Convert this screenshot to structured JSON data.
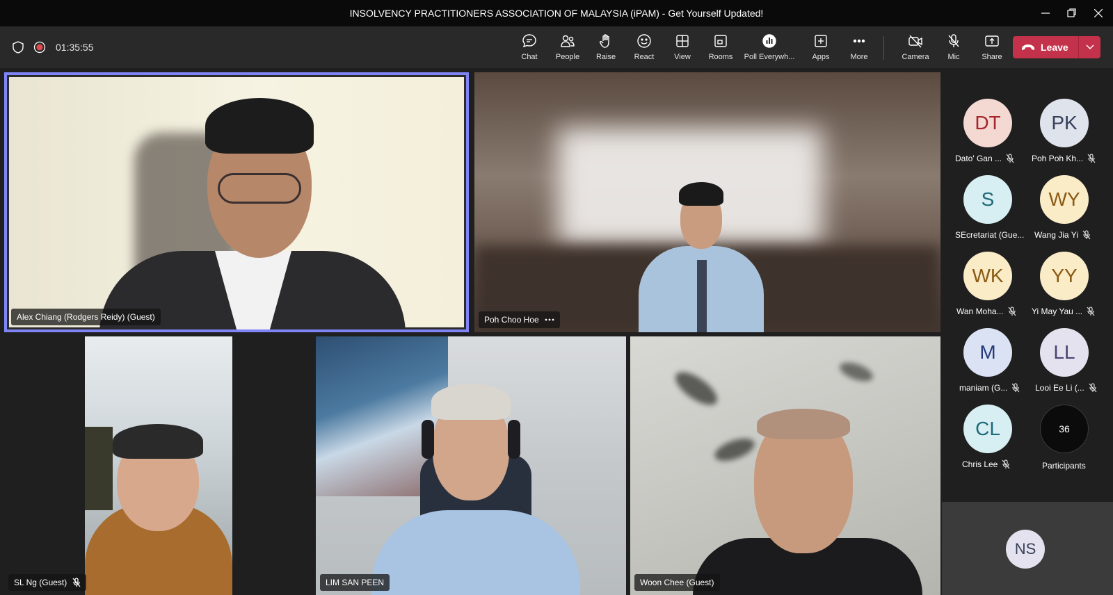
{
  "window": {
    "title": "INSOLVENCY PRACTITIONERS ASSOCIATION OF MALAYSIA (iPAM) - Get Yourself Updated!"
  },
  "meeting": {
    "timer": "01:35:55"
  },
  "toolbar": {
    "chat": "Chat",
    "people": "People",
    "raise": "Raise",
    "react": "React",
    "view": "View",
    "rooms": "Rooms",
    "poll": "Poll Everywh...",
    "apps": "Apps",
    "more": "More",
    "camera": "Camera",
    "mic": "Mic",
    "share": "Share",
    "leave": "Leave"
  },
  "tiles": [
    {
      "name": "Alex Chiang (Rodgers Reidy) (Guest)"
    },
    {
      "name": "Poh Choo Hoe"
    },
    {
      "name": "SL Ng (Guest)"
    },
    {
      "name": "LIM SAN PEEN"
    },
    {
      "name": "Woon Chee (Guest)"
    }
  ],
  "roster": [
    {
      "initials": "DT",
      "name": "Dato' Gan ...",
      "bg": "#f4d8d2",
      "fg": "#a4262c"
    },
    {
      "initials": "PK",
      "name": "Poh Poh Kh...",
      "bg": "#dfe3ec",
      "fg": "#37415a"
    },
    {
      "initials": "S",
      "name": "SEcretariat (Gue...",
      "bg": "#d7eef2",
      "fg": "#1e6a78"
    },
    {
      "initials": "WY",
      "name": "Wang Jia Yi",
      "bg": "#fbecc8",
      "fg": "#8a5a14"
    },
    {
      "initials": "WK",
      "name": "Wan Moha...",
      "bg": "#fbecc8",
      "fg": "#8a5a14"
    },
    {
      "initials": "YY",
      "name": "Yi May Yau ...",
      "bg": "#fbecc8",
      "fg": "#8a5a14"
    },
    {
      "initials": "M",
      "name": "maniam (G...",
      "bg": "#dbe2f4",
      "fg": "#253a7a"
    },
    {
      "initials": "LL",
      "name": "Looi Ee Li (...",
      "bg": "#e4e2ee",
      "fg": "#4a4470"
    },
    {
      "initials": "CL",
      "name": "Chris Lee",
      "bg": "#d7eef2",
      "fg": "#1e6a78"
    }
  ],
  "participants": {
    "count": "36",
    "label": "Participants"
  },
  "self": {
    "initials": "NS"
  }
}
